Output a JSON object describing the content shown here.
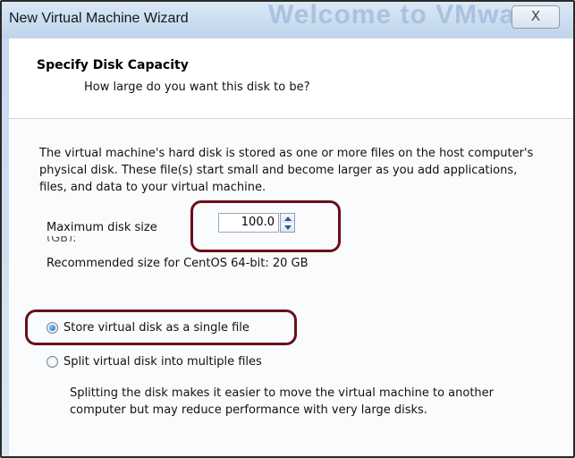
{
  "window": {
    "title": "New Virtual Machine Wizard",
    "background_text": "Welcome to VMwa",
    "close_glyph": "X"
  },
  "header": {
    "title": "Specify Disk Capacity",
    "subtitle": "How large do you want this disk to be?"
  },
  "content": {
    "description": "The virtual machine's hard disk is stored as one or more files on the host computer's physical disk. These file(s) start small and become larger as you add applications, files, and data to your virtual machine.",
    "max_disk_size_label": "Maximum disk size",
    "max_disk_size_value": "100.0",
    "recommended": "Recommended size for CentOS 64-bit: 20 GB",
    "options": [
      {
        "label": "Store virtual disk as a single file",
        "selected": true
      },
      {
        "label": "Split virtual disk into multiple files",
        "selected": false
      }
    ],
    "split_description": "Splitting the disk makes it easier to move the virtual machine to another computer but may reduce performance with very large disks."
  },
  "colors": {
    "annotation": "#6b0f1a",
    "titlebar": "#c9dcef",
    "radio_selected": "#1565b8"
  }
}
